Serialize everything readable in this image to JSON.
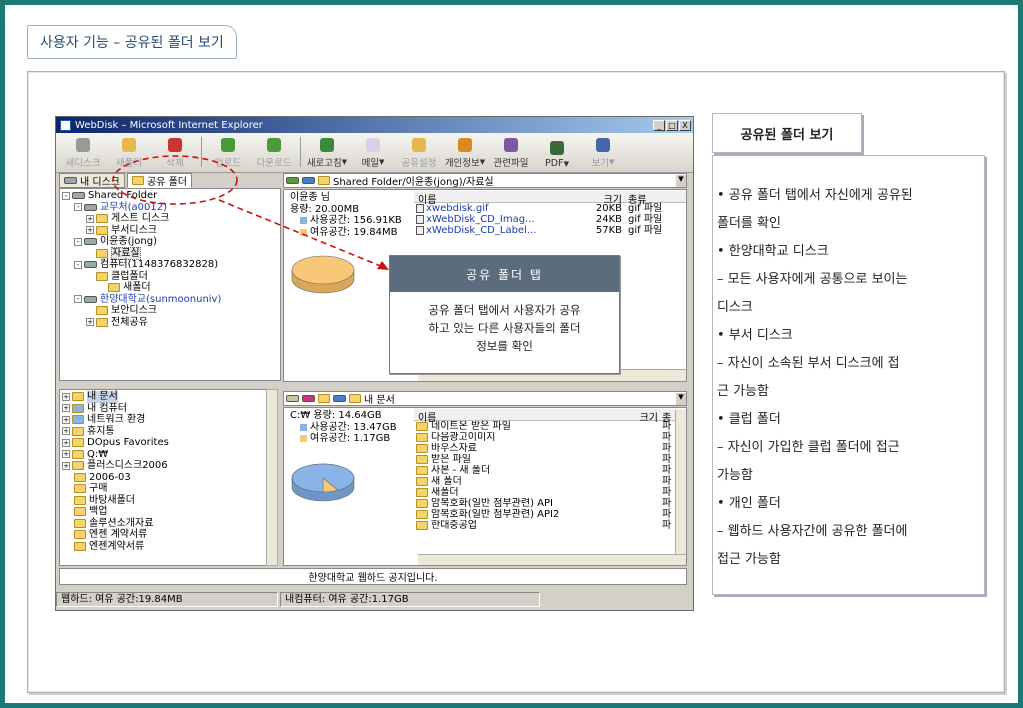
{
  "slide_title": "사용자 기능 – 공유된 폴더 보기",
  "window": {
    "title": "WebDisk – Microsoft Internet Explorer",
    "controls": [
      "_",
      "□",
      "X"
    ]
  },
  "toolbar": [
    {
      "label": "새디스크",
      "icon": "disk-icon",
      "color": "#999",
      "dim": true,
      "arrow": false
    },
    {
      "label": "새폴더",
      "icon": "folder-icon",
      "color": "#e4b84a",
      "dim": true,
      "arrow": false
    },
    {
      "label": "삭제",
      "icon": "delete-icon",
      "color": "#c33",
      "dim": true,
      "arrow": false
    },
    {
      "label": "업로드",
      "icon": "upload-icon",
      "color": "#4a9a3a",
      "dim": true,
      "arrow": false
    },
    {
      "label": "다운로드",
      "icon": "download-icon",
      "color": "#4a9a3a",
      "dim": true,
      "arrow": false
    },
    {
      "label": "새로고침",
      "icon": "refresh-icon",
      "color": "#3a8a3a",
      "dim": false,
      "arrow": true
    },
    {
      "label": "메일",
      "icon": "mail-icon",
      "color": "#dcd0e8",
      "dim": false,
      "arrow": true
    },
    {
      "label": "공유설정",
      "icon": "share-icon",
      "color": "#e4b84a",
      "dim": true,
      "arrow": false
    },
    {
      "label": "개인정보",
      "icon": "person-icon",
      "color": "#d88a20",
      "dim": false,
      "arrow": true
    },
    {
      "label": "관련파일",
      "icon": "related-files-icon",
      "color": "#7a5aa0",
      "dim": false,
      "arrow": false
    },
    {
      "label": "PDF",
      "icon": "pdf-icon",
      "color": "#3a6a3a",
      "dim": false,
      "arrow": true
    },
    {
      "label": "보기",
      "icon": "view-icon",
      "color": "#4466aa",
      "dim": true,
      "arrow": true
    }
  ],
  "tabs": {
    "my_disk": "내 디스크",
    "shared_folder": "공유 폴더"
  },
  "shared_tree": [
    {
      "label": "Shared Folder",
      "kind": "root",
      "indent": 0,
      "blue": false
    },
    {
      "label": "교무처(a0012)",
      "kind": "drive",
      "indent": 1,
      "blue": true
    },
    {
      "label": "게스트 디스크",
      "kind": "folder",
      "indent": 2,
      "blue": false
    },
    {
      "label": "부서디스크",
      "kind": "folder",
      "indent": 2,
      "blue": false
    },
    {
      "label": "이윤종(jong)",
      "kind": "drive",
      "indent": 1,
      "blue": false
    },
    {
      "label": "자료실",
      "kind": "folder",
      "indent": 2,
      "blue": false,
      "selected": true
    },
    {
      "label": "컴퓨터(1148376832828)",
      "kind": "drive",
      "indent": 1,
      "blue": false
    },
    {
      "label": "클럽폴더",
      "kind": "folder",
      "indent": 2,
      "blue": false
    },
    {
      "label": "새폴더",
      "kind": "folder",
      "indent": 3,
      "blue": false
    },
    {
      "label": "한양대학교(sunmoonuniv)",
      "kind": "drive",
      "indent": 1,
      "blue": true
    },
    {
      "label": "보안디스크",
      "kind": "folder",
      "indent": 2,
      "blue": false
    },
    {
      "label": "전체공유",
      "kind": "folder",
      "indent": 2,
      "blue": false
    }
  ],
  "top_right": {
    "path": "Shared Folder/이윤종(jong)/자료실",
    "owner": "이윤종 님",
    "capacity": "용량: 20.00MB",
    "used": "사용공간: 156.91KB",
    "free": "여유공간: 19.84MB",
    "columns": [
      "이름",
      "크기",
      "종류"
    ],
    "files": [
      {
        "name": "xwebdisk.gif",
        "size": "20KB",
        "type": "gif 파일"
      },
      {
        "name": "xWebDisk_CD_Imag...",
        "size": "24KB",
        "type": "gif 파일"
      },
      {
        "name": "xWebDisk_CD_Label...",
        "size": "57KB",
        "type": "gif 파일"
      }
    ]
  },
  "local_tree": [
    "내 문서",
    "내 컴퓨터",
    "네트워크 환경",
    "휴지통",
    "DOpus Favorites",
    "Q:₩",
    "플러스디스크2006",
    "2006-03",
    "구매",
    "바탕새폴더",
    "백업",
    "솔루션소개자료",
    "엔젠 계약서류",
    "엔젠계약서류"
  ],
  "bottom_right": {
    "path": "내 문서",
    "drive": "C:₩   용량: 14.64GB",
    "used": "사용공간: 13.47GB",
    "free": "여유공간: 1.17GB",
    "columns": [
      "이름",
      "크기",
      "종"
    ],
    "files": [
      "네이트온 받은 파일",
      "다음광고이미지",
      "바우스자료",
      "받은 파일",
      "사본 - 새 폴더",
      "새 폴더",
      "새폴더",
      "암복호화(일반 첨부관련) API",
      "암복호화(일반 첨부관련) API2",
      "한대중공업"
    ],
    "type_label": "파"
  },
  "notice": "한양대학교 웹하드 공지입니다.",
  "statusbar": {
    "webhard": "웹하드:   여유 공간:19.84MB",
    "mycomputer": "내컴퓨터:   여유 공간:1.17GB"
  },
  "popup": {
    "title": "공유 폴더 탭",
    "body_lines": [
      "공유 폴더 탭에서 사용자가 공유",
      "하고 있는 다른 사용자들의 폴더",
      "정보를 확인"
    ]
  },
  "side": {
    "title": "공유된 폴더 보기",
    "lines": [
      "• 공유 폴더 탭에서 자신에게 공유된",
      "폴더를 확인",
      "• 한양대학교 디스크",
      " – 모든 사용자에게 공통으로 보이는",
      "디스크",
      "• 부서 디스크",
      " – 자신이 소속된 부서 디스크에 접",
      "근 가능함",
      "• 클럽 폴더",
      " – 자신이 가입한 클럽 폴더에 접근",
      "가능함",
      "• 개인 폴더",
      " – 웹하드 사용자간에 공유한 폴더에",
      "접근 가능함"
    ]
  },
  "pie": {
    "top_used_fraction": 0.008,
    "bottom_used_fraction": 0.92
  },
  "colors": {
    "frame": "#1b7a78",
    "popup_header": "#5b6d7d",
    "pie_free": "#f8c878",
    "pie_used": "#8ab4e8",
    "annotation": "#cc1111"
  }
}
